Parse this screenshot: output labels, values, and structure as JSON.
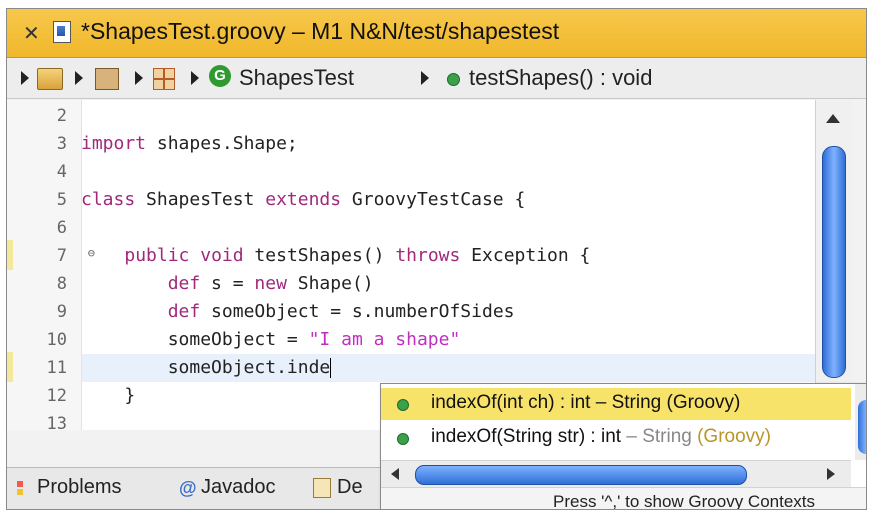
{
  "titlebar": {
    "close_icon": "close-icon",
    "file_icon": "groovy-file-icon",
    "title": "*ShapesTest.groovy – M1 N&N/test/shapestest"
  },
  "breadcrumb": {
    "items": [
      {
        "icon": "project-icon"
      },
      {
        "icon": "package-folder-icon"
      },
      {
        "icon": "package-icon"
      },
      {
        "icon": "class-icon",
        "label": "ShapesTest"
      },
      {
        "icon": "method-icon",
        "label": "testShapes() : void"
      }
    ]
  },
  "editor": {
    "lines": [
      {
        "num": "2",
        "text": ""
      },
      {
        "num": "3",
        "text": "import shapes.Shape;"
      },
      {
        "num": "4",
        "text": ""
      },
      {
        "num": "5",
        "text": "class ShapesTest extends GroovyTestCase {"
      },
      {
        "num": "6",
        "text": ""
      },
      {
        "num": "7",
        "text": "    public void testShapes() throws Exception {"
      },
      {
        "num": "8",
        "text": "        def s = new Shape()"
      },
      {
        "num": "9",
        "text": "        def someObject = s.numberOfSides"
      },
      {
        "num": "10",
        "text": "        someObject = \"I am a shape\""
      },
      {
        "num": "11",
        "text": "        someObject.inde"
      },
      {
        "num": "12",
        "text": "    }"
      },
      {
        "num": "13",
        "text": ""
      }
    ],
    "tokens": {
      "import": "import",
      "import_rest": " shapes.Shape;",
      "class": "class",
      "class_name": " ShapesTest ",
      "extends": "extends",
      "class_rest": " GroovyTestCase {",
      "public": "public",
      "void": "void",
      "method_name": " testShapes() ",
      "throws": "throws",
      "method_rest": " Exception {",
      "def": "def",
      "l8_a": " s = ",
      "new": "new",
      "l8_b": " Shape()",
      "l9_rest": " someObject = s.numberOfSides",
      "l10_a": "someObject = ",
      "l10_str": "\"I am a shape\"",
      "l11": "someObject.inde",
      "l12": "}"
    }
  },
  "completion": {
    "proposals": [
      {
        "name": "indexOf(int ch) : int",
        "owner": "– String (Groovy)"
      },
      {
        "name": "indexOf(String str) : int",
        "owner_dash": "– String",
        "owner_tag": "(Groovy)"
      }
    ],
    "status": "Press '^,' to show Groovy Contexts"
  },
  "bottom_tabs": [
    {
      "label": "Problems",
      "icon": "problems-icon"
    },
    {
      "label": "Javadoc",
      "icon": "javadoc-icon"
    },
    {
      "label": "De",
      "icon": "declaration-icon"
    }
  ]
}
